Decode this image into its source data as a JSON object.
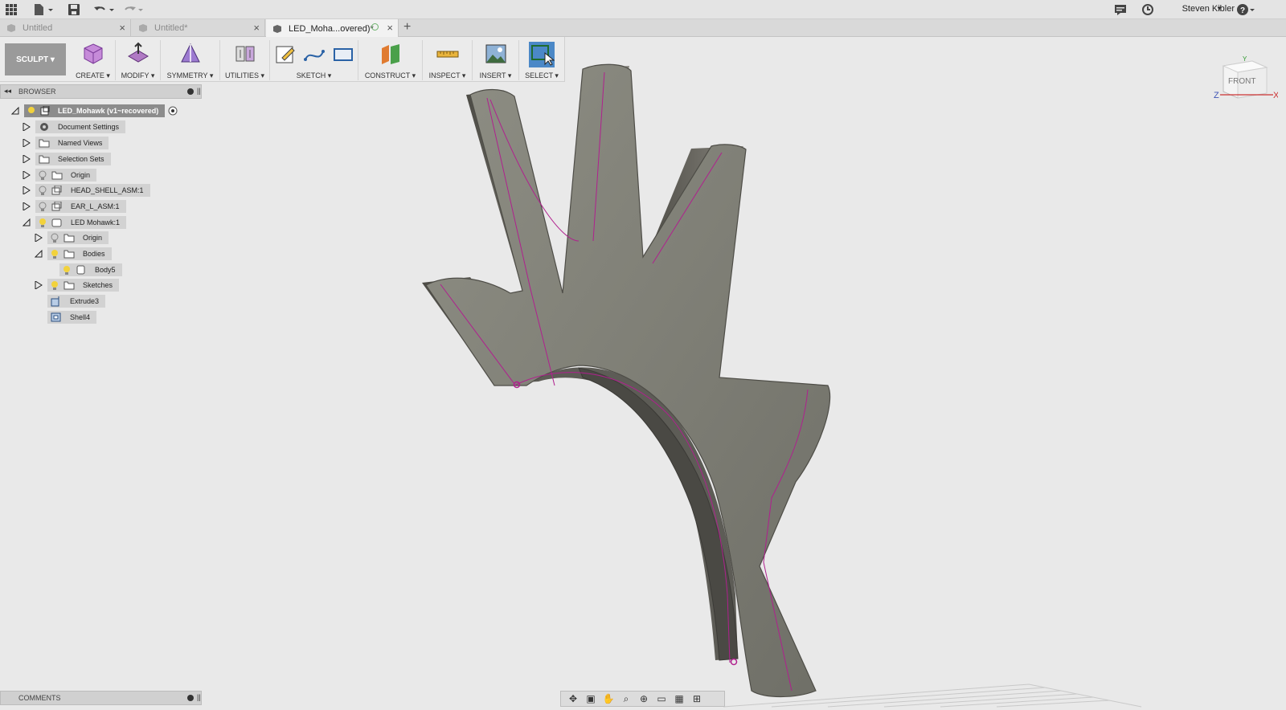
{
  "app_bar": {
    "user_name": "Steven Kibler",
    "help_icon": "?"
  },
  "tabs": [
    {
      "label": "Untitled",
      "close": "×",
      "active": false
    },
    {
      "label": "Untitled*",
      "close": "×",
      "active": false
    },
    {
      "label": "LED_Moha...overed)*",
      "close": "×",
      "active": true
    }
  ],
  "add_tab": "+",
  "toolbar": {
    "workspace": "SCULPT ▾",
    "groups": [
      "CREATE ▾",
      "MODIFY ▾",
      "SYMMETRY ▾",
      "UTILITIES ▾",
      "SKETCH ▾",
      "CONSTRUCT ▾",
      "INSPECT ▾",
      "INSERT ▾",
      "SELECT ▾"
    ]
  },
  "browser": {
    "title": "BROWSER",
    "root": "LED_Mohawk (v1~recovered)",
    "items": [
      {
        "label": "Document Settings",
        "icon": "gear-icon"
      },
      {
        "label": "Named Views",
        "icon": "folder-icon"
      },
      {
        "label": "Selection Sets",
        "icon": "folder-icon"
      },
      {
        "label": "Origin",
        "icon": "folder-icon"
      },
      {
        "label": "HEAD_SHELL_ASM:1",
        "icon": "component-icon"
      },
      {
        "label": "EAR_L_ASM:1",
        "icon": "component-icon"
      },
      {
        "label": "LED Mohawk:1",
        "icon": "component-icon"
      },
      {
        "label": "Origin",
        "icon": "folder-icon"
      },
      {
        "label": "Bodies",
        "icon": "folder-icon"
      },
      {
        "label": "Body5",
        "icon": "body-icon"
      },
      {
        "label": "Sketches",
        "icon": "folder-icon"
      },
      {
        "label": "Extrude3",
        "icon": "extrude-icon"
      },
      {
        "label": "Shell4",
        "icon": "shell-icon"
      }
    ]
  },
  "comments": {
    "title": "COMMENTS"
  },
  "viewcube": {
    "face": "FRONT",
    "axis_z": "Z",
    "axis_x": "X",
    "axis_y": "Y"
  }
}
